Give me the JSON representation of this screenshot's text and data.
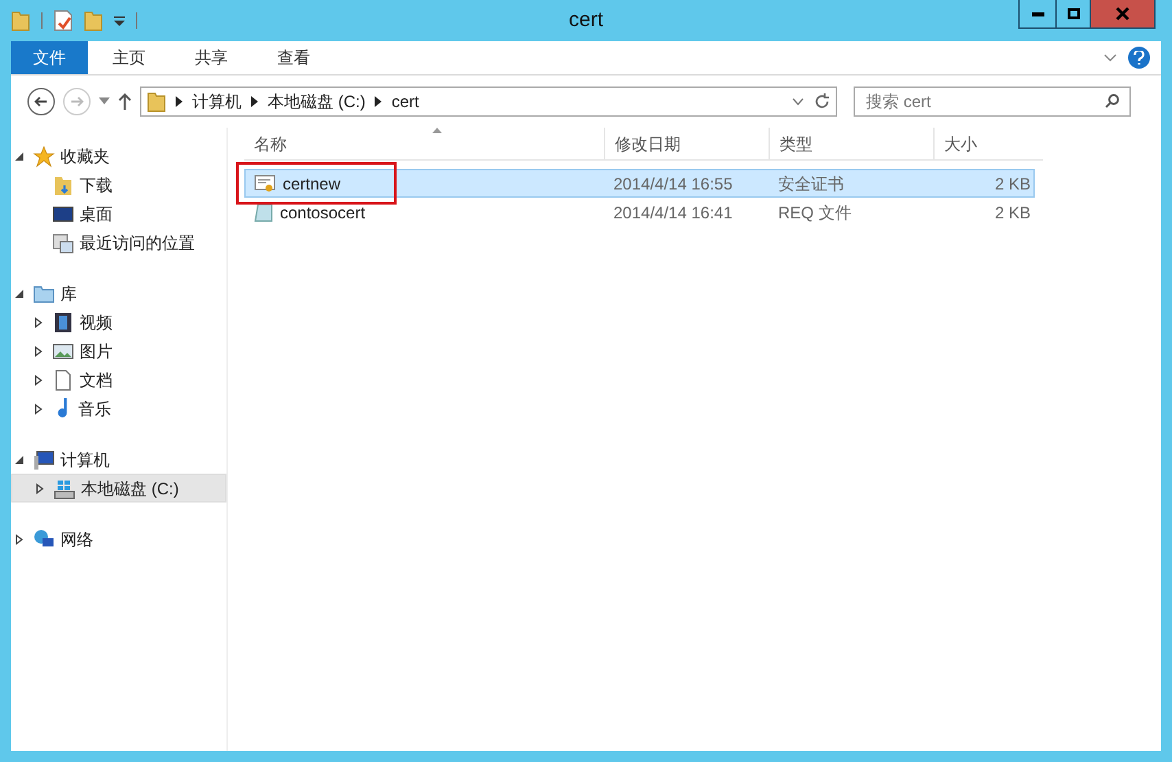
{
  "window": {
    "title": "cert"
  },
  "ribbon_tabs": [
    {
      "label": "文件",
      "selected": true
    },
    {
      "label": "主页",
      "selected": false
    },
    {
      "label": "共享",
      "selected": false
    },
    {
      "label": "查看",
      "selected": false
    }
  ],
  "address": {
    "segments": [
      "计算机",
      "本地磁盘 (C:)",
      "cert"
    ]
  },
  "search": {
    "placeholder": "搜索 cert"
  },
  "nav": [
    {
      "label": "收藏夹",
      "kind": "favorites",
      "expanded": true,
      "selected": false,
      "children": [
        {
          "label": "下载",
          "kind": "download",
          "expandable": false,
          "selected": false
        },
        {
          "label": "桌面",
          "kind": "desktop",
          "expandable": false,
          "selected": false
        },
        {
          "label": "最近访问的位置",
          "kind": "recent",
          "expandable": false,
          "selected": false
        }
      ]
    },
    {
      "label": "库",
      "kind": "library",
      "expanded": true,
      "selected": false,
      "children": [
        {
          "label": "视频",
          "kind": "video",
          "expandable": true,
          "selected": false
        },
        {
          "label": "图片",
          "kind": "picture",
          "expandable": true,
          "selected": false
        },
        {
          "label": "文档",
          "kind": "document",
          "expandable": true,
          "selected": false
        },
        {
          "label": "音乐",
          "kind": "music",
          "expandable": true,
          "selected": false
        }
      ]
    },
    {
      "label": "计算机",
      "kind": "computer",
      "expanded": true,
      "selected": false,
      "children": [
        {
          "label": "本地磁盘 (C:)",
          "kind": "drive",
          "expandable": true,
          "selected": true
        }
      ]
    },
    {
      "label": "网络",
      "kind": "network",
      "expanded": false,
      "selected": false
    }
  ],
  "table": {
    "columns": [
      "名称",
      "修改日期",
      "类型",
      "大小"
    ],
    "rows": [
      {
        "name": "certnew",
        "kind": "certificate",
        "modified": "2014/4/14 16:55",
        "type": "安全证书",
        "size": "2 KB",
        "selected": true,
        "annotated": true
      },
      {
        "name": "contosocert",
        "kind": "file",
        "modified": "2014/4/14 16:41",
        "type": "REQ 文件",
        "size": "2 KB",
        "selected": false,
        "annotated": false
      }
    ]
  }
}
